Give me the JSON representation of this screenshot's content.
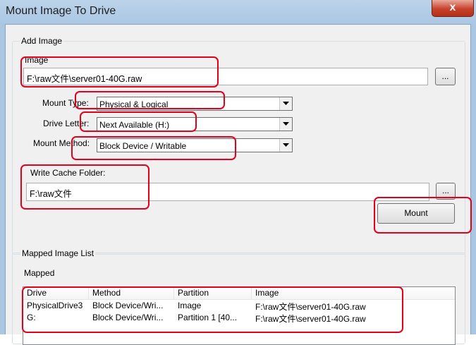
{
  "window": {
    "title": "Mount Image To Drive",
    "close_glyph": "x"
  },
  "add_image": {
    "group_label": "Add Image",
    "image_label": "Image",
    "image_path": "F:\\raw文件\\server01-40G.raw",
    "browse_label": "...",
    "mount_type_label": "Mount Type:",
    "mount_type_value": "Physical & Logical",
    "drive_letter_label": "Drive Letter:",
    "drive_letter_value": "Next Available (H:)",
    "mount_method_label": "Mount Method:",
    "mount_method_value": "Block Device / Writable",
    "write_cache_label": "Write Cache Folder:",
    "write_cache_path": "F:\\raw文件",
    "cache_browse_label": "...",
    "mount_button_label": "Mount"
  },
  "mapped_list": {
    "group_label": "Mapped Image List",
    "sublabel": "Mapped",
    "columns": [
      "Drive",
      "Method",
      "Partition",
      "Image"
    ],
    "rows": [
      [
        "PhysicalDrive3",
        "Block Device/Wri...",
        "Image",
        "F:\\raw文件\\server01-40G.raw"
      ],
      [
        "G:",
        "Block Device/Wri...",
        "Partition 1 [40...",
        "F:\\raw文件\\server01-40G.raw"
      ]
    ]
  },
  "colors": {
    "annotation": "#e3001b",
    "title_bar": "#a9c6e3",
    "dialog_bg": "#f0f0f0"
  },
  "icons": {
    "close": "close-icon",
    "dropdown": "chevron-down-icon"
  }
}
